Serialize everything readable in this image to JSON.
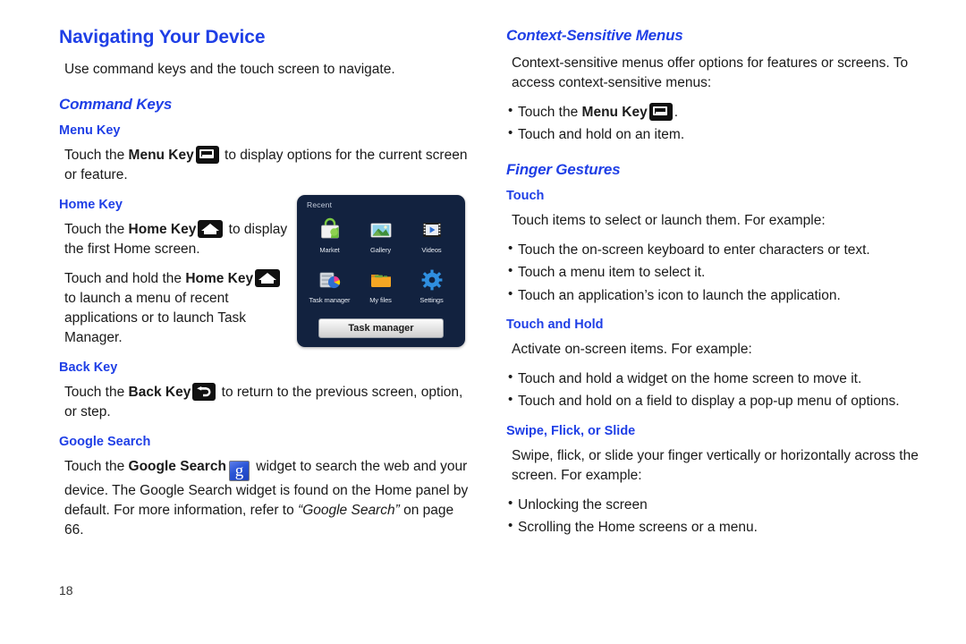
{
  "page": {
    "number": "18",
    "accent_color": "#1f3fe6",
    "text_color": "#1a1a1a",
    "background": "#ffffff"
  },
  "left_column": {
    "title": "Navigating Your Device",
    "intro": "Use command keys and the touch screen to navigate.",
    "command_keys": {
      "heading": "Command Keys",
      "menu_key": {
        "heading": "Menu Key",
        "body_prefix": "Touch the ",
        "body_bold": "Menu Key",
        "body_suffix": " to display options for the current screen or feature.",
        "icon": "menu-key-icon"
      },
      "home_key": {
        "heading": "Home Key",
        "para1_prefix": "Touch the ",
        "para1_bold": "Home Key",
        "para1_suffix": " to display the first Home screen.",
        "para2_prefix": "Touch and hold the ",
        "para2_bold": "Home Key",
        "para2_suffix": " to launch a menu of recent applications or to launch Task Manager.",
        "icon": "home-key-icon"
      },
      "back_key": {
        "heading": "Back Key",
        "body_prefix": "Touch the ",
        "body_bold": "Back Key",
        "body_suffix": " to return to the previous screen, option, or step.",
        "icon": "back-key-icon"
      },
      "google_search": {
        "heading": "Google Search",
        "body_prefix": "Touch the ",
        "body_bold": "Google Search",
        "body_mid": " widget to search the web and your device. The Google Search widget is found on the Home panel by default. For more information, refer to ",
        "body_ref": "“Google Search”",
        "body_suffix": " on page 66.",
        "icon": "google-search-icon"
      }
    }
  },
  "device_screenshot": {
    "panel_label": "Recent",
    "apps": [
      {
        "name": "Market",
        "icon": "market-icon"
      },
      {
        "name": "Gallery",
        "icon": "gallery-icon"
      },
      {
        "name": "Videos",
        "icon": "videos-icon"
      },
      {
        "name": "Task manager",
        "icon": "task-manager-icon"
      },
      {
        "name": "My files",
        "icon": "my-files-icon"
      },
      {
        "name": "Settings",
        "icon": "settings-icon"
      }
    ],
    "button_label": "Task manager"
  },
  "right_column": {
    "context_menus": {
      "heading": "Context-Sensitive Menus",
      "body": "Context-sensitive menus offer options for features or screens. To access context-sensitive menus:",
      "bullet1_prefix": "Touch the ",
      "bullet1_bold": "Menu Key",
      "bullet1_suffix": ".",
      "bullet2": "Touch and hold on an item."
    },
    "finger_gestures": {
      "heading": "Finger Gestures",
      "touch": {
        "heading": "Touch",
        "body": "Touch items to select or launch them. For example:",
        "bullets": [
          "Touch the on-screen keyboard to enter characters or text.",
          "Touch a menu item to select it.",
          "Touch an application’s icon to launch the application."
        ]
      },
      "touch_and_hold": {
        "heading": "Touch and Hold",
        "body": "Activate on-screen items. For example:",
        "bullets": [
          "Touch and hold a widget on the home screen to move it.",
          "Touch and hold on a field to display a pop-up menu of options."
        ]
      },
      "swipe": {
        "heading": "Swipe, Flick, or Slide",
        "body": "Swipe, flick, or slide your finger vertically or horizontally across the screen. For example:",
        "bullets": [
          "Unlocking the screen",
          "Scrolling the Home screens or a menu."
        ]
      }
    }
  }
}
